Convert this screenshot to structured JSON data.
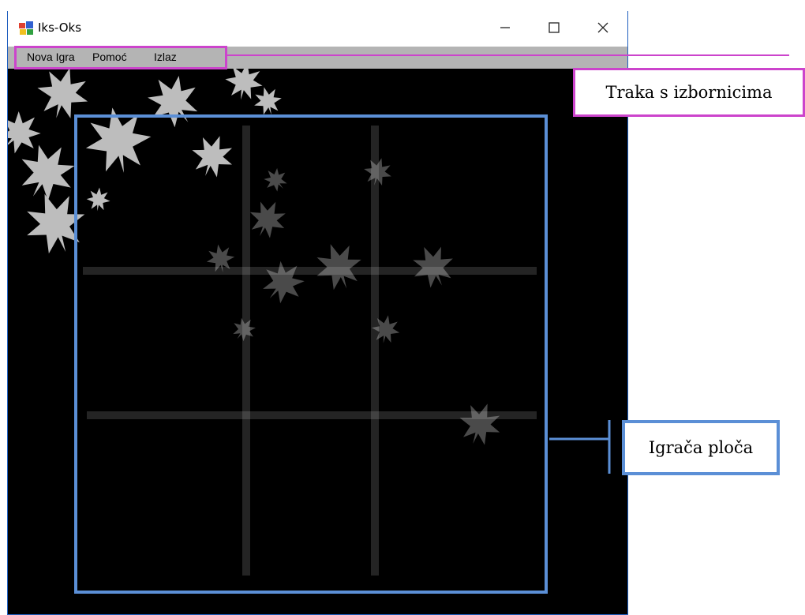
{
  "window": {
    "title": "Iks-Oks",
    "icon": "app-icon",
    "controls": [
      "minimize-icon",
      "maximize-icon",
      "close-icon"
    ]
  },
  "menu": {
    "items": [
      {
        "label": "Nova Igra"
      },
      {
        "label": "Pomoć"
      },
      {
        "label": "Izlaz"
      }
    ]
  },
  "annotations": {
    "menu_label": "Traka s izbornicima",
    "board_label": "Igrača ploča"
  },
  "colors": {
    "menu_highlight": "#cc44cc",
    "board_highlight": "#5b8fd6",
    "background": "#000000",
    "menubar": "#b4b4b4"
  }
}
